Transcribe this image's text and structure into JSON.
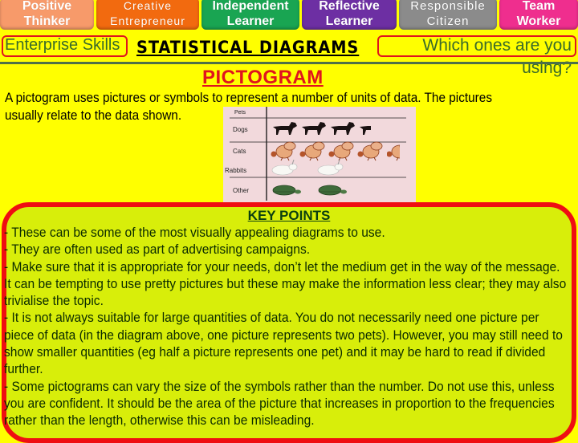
{
  "skills": [
    {
      "line1": "Positive",
      "line2": "Thinker",
      "color": "#f79a6a"
    },
    {
      "line1": "Creative",
      "line2": "Entrepreneur",
      "color": "#f26a0f"
    },
    {
      "line1": "Independent",
      "line2": "Learner",
      "color": "#19a552"
    },
    {
      "line1": "Reflective",
      "line2": "Learner",
      "color": "#6d2fa3"
    },
    {
      "line1": "Responsible",
      "line2": "Citizen",
      "color": "#8b8b8b"
    },
    {
      "line1": "Team",
      "line2": "Worker",
      "color": "#ef2e8e"
    }
  ],
  "header": {
    "enterprise_label": "Enterprise Skills",
    "section_title": "STATISTICAL DIAGRAMS",
    "question": "Which ones are you using?"
  },
  "page_title": "PICTOGRAM",
  "intro": {
    "line1": "A pictogram uses pictures or symbols to represent a number of units of data. The pictures",
    "line2": "usually relate to the data shown."
  },
  "chart_data": {
    "type": "pictogram",
    "header_label": "Pets",
    "categories": [
      "Dogs",
      "Cats",
      "Rabbits",
      "Other"
    ],
    "icons": [
      "dog",
      "cat",
      "rabbit",
      "tortoise"
    ],
    "symbol_counts": [
      3.5,
      4.5,
      2,
      2
    ],
    "units_per_symbol": 2,
    "values": [
      7,
      9,
      4,
      4
    ]
  },
  "key_points": {
    "title": "KEY POINTS",
    "items": [
      "- These can be some of the most visually appealing diagrams to use.",
      " - They are often used as part of advertising campaigns.",
      " - Make sure that it is appropriate for your needs, don’t let the medium get in the way of the message. It can be tempting to use pretty pictures but these may make the information less clear; they may also trivialise the topic.",
      " - It is not always suitable for large quantities of data. You do not necessarily need one picture per piece of data (in the diagram above, one picture represents two pets). However, you may still need to show smaller quantities (eg half a picture represents one pet) and it may be hard to read if divided further.",
      " - Some pictograms can vary the size of the symbols rather than the number. Do not use this, unless you are confident. It should be the area of the picture that increases in proportion to the frequencies rather than the length, otherwise this can be misleading."
    ]
  },
  "colors": {
    "background": "#ffff00",
    "accent_red": "#e0141e",
    "keypoints_bg": "#d8ee0a",
    "header_green": "#3a6a2a"
  }
}
